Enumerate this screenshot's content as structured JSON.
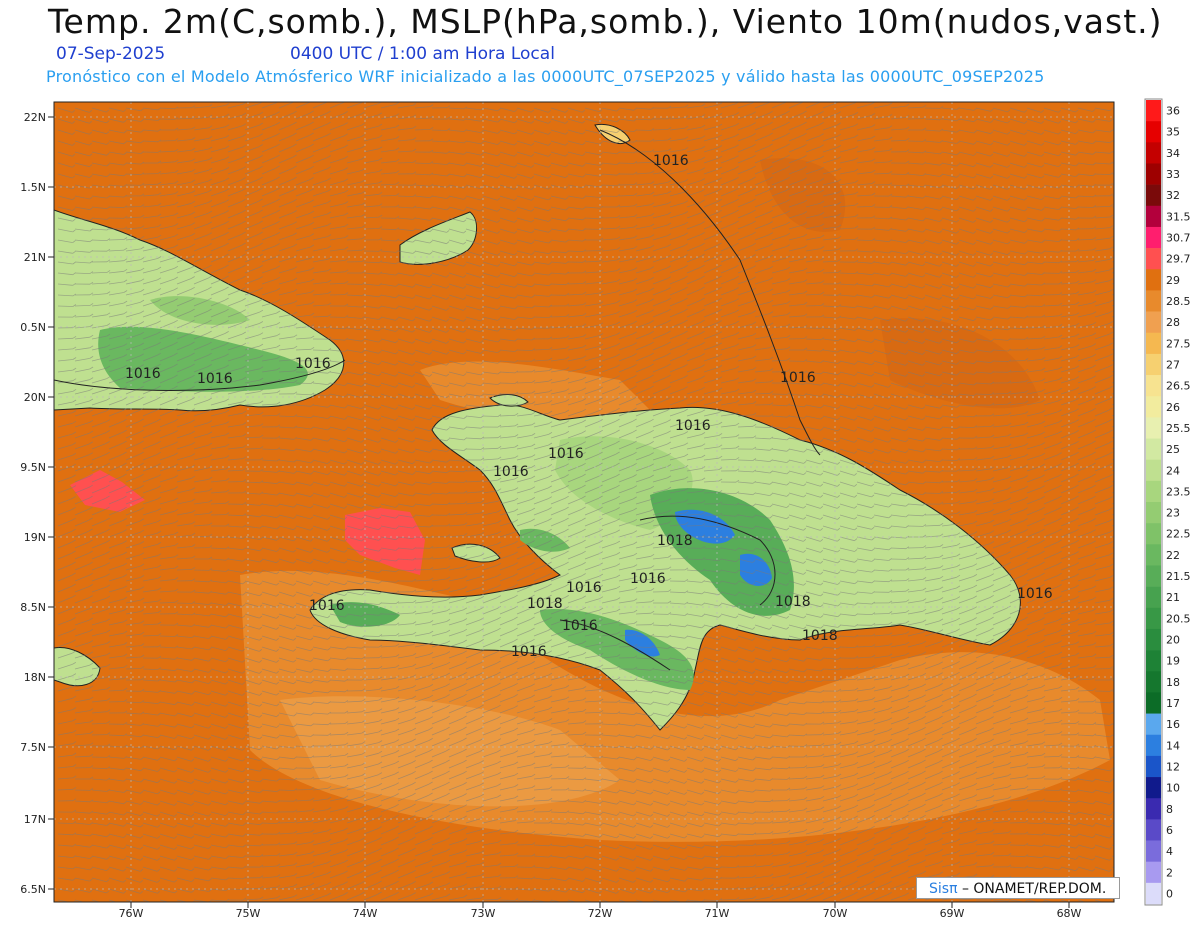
{
  "title": "Temp. 2m(C,somb.), MSLP(hPa,somb.), Viento 10m(nudos,vast.)",
  "date": "07-Sep-2025",
  "time": "0400 UTC / 1:00 am Hora Local",
  "subtitle": "Pronóstico con el Modelo Atmósferico WRF inicializado a las 0000UTC_07SEP2025 y válido hasta las  0000UTC_09SEP2025",
  "credit": {
    "brand": "Sisπ",
    "org": "– ONAMET/REP.DOM."
  },
  "lat_labels": [
    "22N",
    "1.5N",
    "21N",
    "0.5N",
    "20N",
    "9.5N",
    "19N",
    "8.5N",
    "18N",
    "7.5N",
    "17N",
    "6.5N"
  ],
  "lon_labels": [
    "76W",
    "75W",
    "74W",
    "73W",
    "72W",
    "71W",
    "70W",
    "69W",
    "68W"
  ],
  "isobar_labels": [
    "1016",
    "1016",
    "1016",
    "1016",
    "1016",
    "1016",
    "1016",
    "1016",
    "1018",
    "1016",
    "1018",
    "1016",
    "1018",
    "1016",
    "1018",
    "1016",
    "1016",
    "1016"
  ],
  "legend": [
    {
      "label": "36",
      "color": "#ff1a1a"
    },
    {
      "label": "35",
      "color": "#e60000"
    },
    {
      "label": "34",
      "color": "#c40000"
    },
    {
      "label": "33",
      "color": "#9e0000"
    },
    {
      "label": "32",
      "color": "#7a0a0a"
    },
    {
      "label": "31.5",
      "color": "#b3003c"
    },
    {
      "label": "30.7",
      "color": "#ff1e6e"
    },
    {
      "label": "29.7",
      "color": "#ff5050"
    },
    {
      "label": "29",
      "color": "#e07010"
    },
    {
      "label": "28.5",
      "color": "#e88a2c"
    },
    {
      "label": "28",
      "color": "#f0a050"
    },
    {
      "label": "27.5",
      "color": "#f5b850"
    },
    {
      "label": "27",
      "color": "#f6d070"
    },
    {
      "label": "26.5",
      "color": "#f7e390"
    },
    {
      "label": "26",
      "color": "#f2ec9e"
    },
    {
      "label": "25.5",
      "color": "#e8f0b0"
    },
    {
      "label": "25",
      "color": "#d2e9a2"
    },
    {
      "label": "24",
      "color": "#bfe090"
    },
    {
      "label": "23.5",
      "color": "#a8d67e"
    },
    {
      "label": "23",
      "color": "#94cc72"
    },
    {
      "label": "22.5",
      "color": "#7fc268"
    },
    {
      "label": "22",
      "color": "#6ab860"
    },
    {
      "label": "21.5",
      "color": "#58ad58"
    },
    {
      "label": "21",
      "color": "#47a24f"
    },
    {
      "label": "20.5",
      "color": "#389846"
    },
    {
      "label": "20",
      "color": "#2a8d3e"
    },
    {
      "label": "19",
      "color": "#1e8236"
    },
    {
      "label": "18",
      "color": "#15772e"
    },
    {
      "label": "17",
      "color": "#0c6c27"
    },
    {
      "label": "16",
      "color": "#5aa8ee"
    },
    {
      "label": "14",
      "color": "#2c7fe0"
    },
    {
      "label": "12",
      "color": "#1a55c9"
    },
    {
      "label": "10",
      "color": "#101a8c"
    },
    {
      "label": "8",
      "color": "#3a2ab0"
    },
    {
      "label": "6",
      "color": "#5a4ac8"
    },
    {
      "label": "4",
      "color": "#7a6cdc"
    },
    {
      "label": "2",
      "color": "#a89af0"
    },
    {
      "label": "0",
      "color": "#dcdcfa"
    }
  ]
}
